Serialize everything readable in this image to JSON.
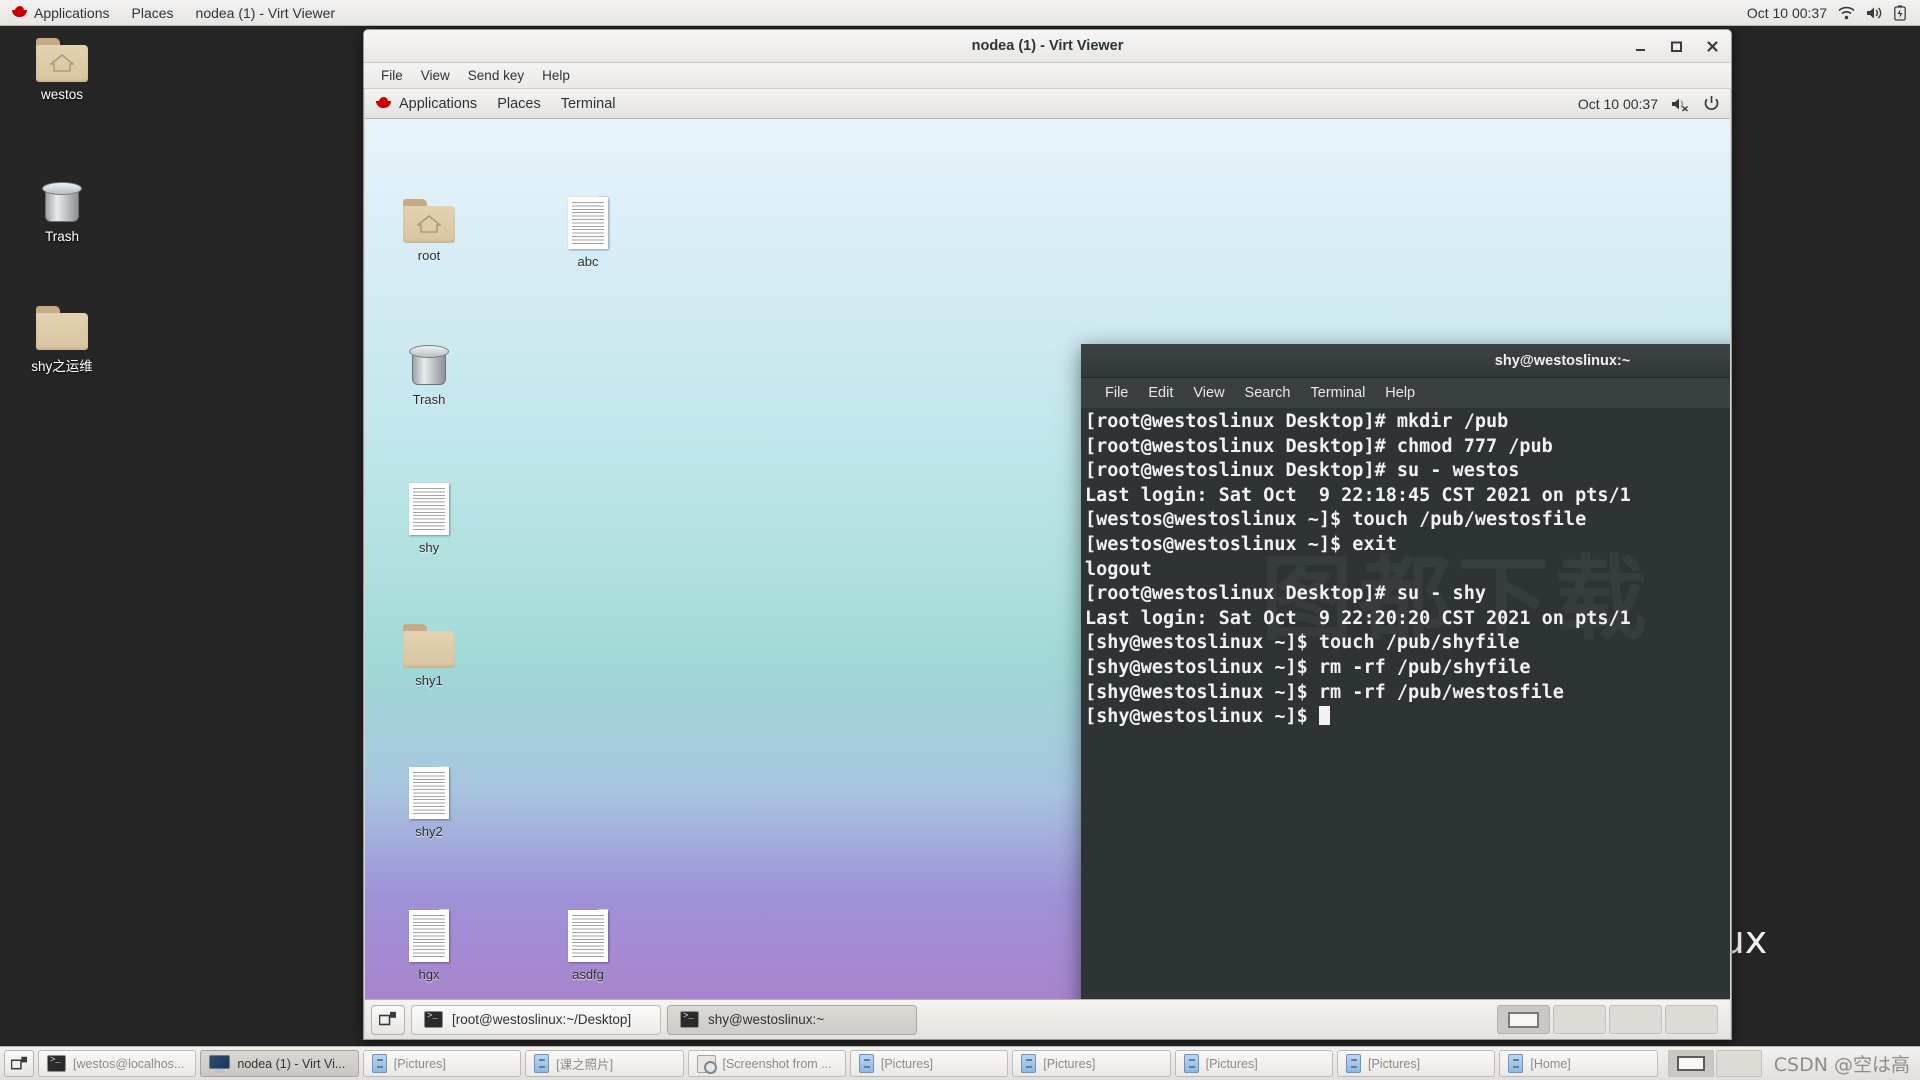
{
  "host": {
    "top_panel": {
      "logo": "redhat-logo",
      "menus": [
        "Applications",
        "Places"
      ],
      "window_title": "nodea (1) - Virt Viewer",
      "clock": "Oct 10  00:37",
      "tray_icons": [
        "wifi-icon",
        "volume-icon",
        "battery-icon"
      ]
    },
    "desktop_icons": [
      {
        "label": "westos",
        "type": "home-folder"
      },
      {
        "label": "Trash",
        "type": "trash"
      },
      {
        "label": "shy之运维",
        "type": "folder"
      }
    ],
    "wallpaper_text": "inux",
    "taskbar": {
      "show_desktop": "show-desktop-icon",
      "tasks": [
        {
          "label": "[westos@localhos...",
          "icon": "terminal-icon",
          "active": false
        },
        {
          "label": "nodea (1) - Virt Vi...",
          "icon": "monitor-icon",
          "active": true
        },
        {
          "label": "[Pictures]",
          "icon": "file-manager-icon",
          "active": false
        },
        {
          "label": "[课之照片]",
          "icon": "file-manager-icon",
          "active": false
        },
        {
          "label": "[Screenshot from ...",
          "icon": "screenshot-icon",
          "active": false
        },
        {
          "label": "[Pictures]",
          "icon": "file-manager-icon",
          "active": false
        },
        {
          "label": "[Pictures]",
          "icon": "file-manager-icon",
          "active": false
        },
        {
          "label": "[Pictures]",
          "icon": "file-manager-icon",
          "active": false
        },
        {
          "label": "[Pictures]",
          "icon": "file-manager-icon",
          "active": false
        },
        {
          "label": "[Home]",
          "icon": "file-manager-icon",
          "active": false
        }
      ],
      "workspaces": [
        {
          "active": true
        },
        {
          "active": false
        }
      ],
      "watermark": "CSDN @空は高"
    }
  },
  "virt_viewer": {
    "title": "nodea (1) - Virt Viewer",
    "menus": [
      "File",
      "View",
      "Send key",
      "Help"
    ],
    "window_buttons": [
      "minimize-icon",
      "maximize-icon",
      "close-icon"
    ]
  },
  "guest": {
    "top_panel": {
      "logo": "redhat-logo",
      "menus": [
        "Applications",
        "Places",
        "Terminal"
      ],
      "clock": "Oct 10  00:37",
      "tray_icons": [
        "volume-muted-icon",
        "power-icon"
      ]
    },
    "desktop_icons": [
      {
        "label": "root",
        "type": "home-folder"
      },
      {
        "label": "abc",
        "type": "document"
      },
      {
        "label": "Trash",
        "type": "trash"
      },
      {
        "label": "shy",
        "type": "document"
      },
      {
        "label": "shy1",
        "type": "folder"
      },
      {
        "label": "shy2",
        "type": "document"
      },
      {
        "label": "hgx",
        "type": "document"
      },
      {
        "label": "asdfg",
        "type": "document"
      }
    ],
    "taskbar": {
      "show_desktop": "show-desktop-icon",
      "tasks": [
        {
          "label": "[root@westoslinux:~/Desktop]",
          "active": false
        },
        {
          "label": "shy@westoslinux:~",
          "active": true
        }
      ],
      "workspaces": [
        {
          "active": true
        },
        {
          "active": false
        },
        {
          "active": false
        },
        {
          "active": false
        }
      ]
    }
  },
  "terminal": {
    "title": "shy@westoslinux:~",
    "menus": [
      "File",
      "Edit",
      "View",
      "Search",
      "Terminal",
      "Help"
    ],
    "watermark": "图都下载",
    "lines": [
      "[root@westoslinux Desktop]# mkdir /pub",
      "[root@westoslinux Desktop]# chmod 777 /pub",
      "[root@westoslinux Desktop]# su - westos",
      "Last login: Sat Oct  9 22:18:45 CST 2021 on pts/1",
      "[westos@westoslinux ~]$ touch /pub/westosfile",
      "[westos@westoslinux ~]$ exit",
      "logout",
      "[root@westoslinux Desktop]# su - shy",
      "Last login: Sat Oct  9 22:20:20 CST 2021 on pts/1",
      "[shy@westoslinux ~]$ touch /pub/shyfile",
      "[shy@westoslinux ~]$ rm -rf /pub/shyfile",
      "[shy@westoslinux ~]$ rm -rf /pub/westosfile"
    ],
    "prompt": "[shy@westoslinux ~]$ ",
    "colors": {
      "background": "#2e3436",
      "foreground": "#f2f2f2"
    }
  }
}
